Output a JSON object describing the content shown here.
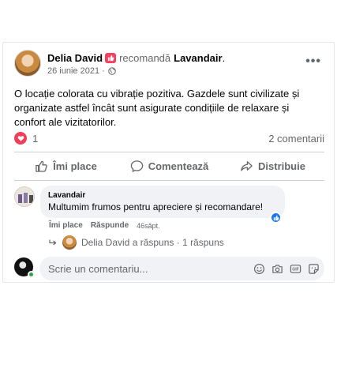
{
  "post": {
    "author": "Delia David",
    "verb": "recomandă",
    "page": "Lavandair",
    "punct": ".",
    "date": "26 iunie 2021",
    "date_sep": "·",
    "more": "•••",
    "body": "O locație colorata cu vibrație pozitiva. Gazdele sunt civilizate și organizate astfel încât sunt asigurate condițiile de relaxare și confort ale vizitatorilor.",
    "likes": "1",
    "comments": "2 comentarii"
  },
  "actions": {
    "like": "Îmi place",
    "comment": "Comentează",
    "share": "Distribuie"
  },
  "comment": {
    "author": "Lavandair",
    "text": "Multumim frumos pentru apreciere și recomandare!",
    "like": "Îmi place",
    "reply": "Răspunde",
    "time": "46săpt."
  },
  "replies": {
    "text": "Delia David a răspuns · 1 răspuns"
  },
  "write": {
    "placeholder": "Scrie un comentariu..."
  },
  "colors": {
    "accent": "#1877f2",
    "heart": "#f33e58",
    "badge": "#f3425f",
    "online": "#31a24c"
  }
}
